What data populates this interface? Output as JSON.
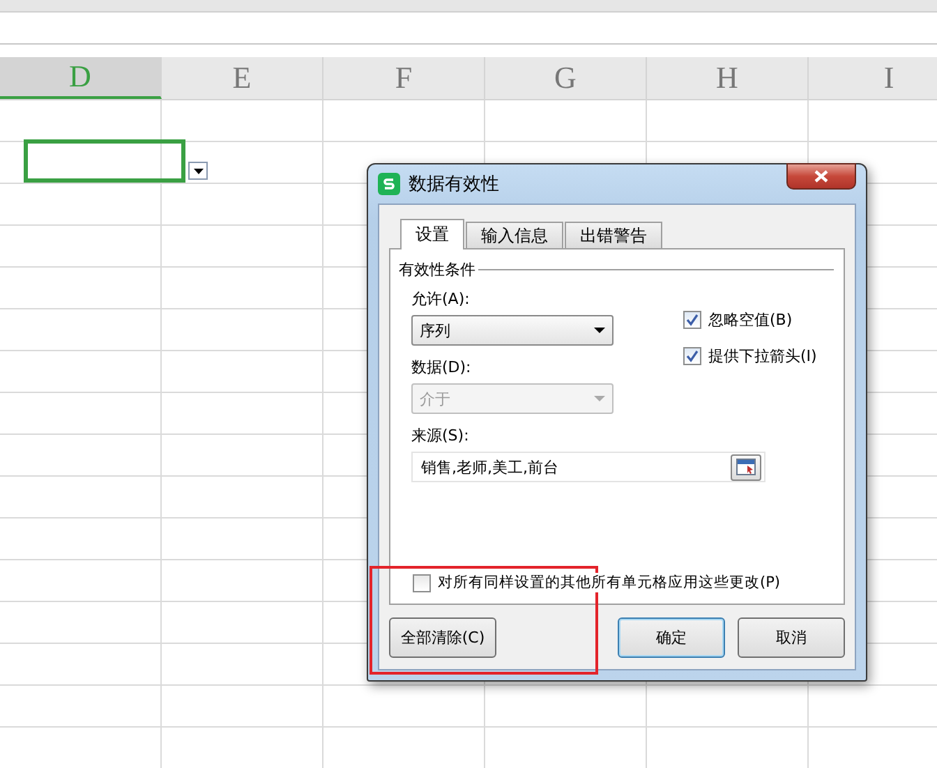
{
  "sheet": {
    "columns": [
      {
        "label": "D",
        "selected": true
      },
      {
        "label": "E",
        "selected": false
      },
      {
        "label": "F",
        "selected": false
      },
      {
        "label": "G",
        "selected": false
      },
      {
        "label": "H",
        "selected": false
      },
      {
        "label": "I",
        "selected": false
      }
    ]
  },
  "dialog": {
    "title": "数据有效性",
    "tabs": [
      {
        "label": "设置",
        "selected": true
      },
      {
        "label": "输入信息",
        "selected": false
      },
      {
        "label": "出错警告",
        "selected": false
      }
    ],
    "group": "有效性条件",
    "allow": {
      "label": "允许(A):",
      "value": "序列",
      "disabled": false
    },
    "data": {
      "label": "数据(D):",
      "value": "介于",
      "disabled": true
    },
    "options": [
      {
        "label": "忽略空值(B)",
        "checked": true
      },
      {
        "label": "提供下拉箭头(I)",
        "checked": true
      }
    ],
    "source": {
      "label": "来源(S):",
      "value": "销售,老师,美工,前台"
    },
    "apply_all": {
      "label": "对所有同样设置的其他所有单元格应用这些更改(P)",
      "checked": false
    },
    "buttons": [
      {
        "label": "全部清除(C)",
        "kind": "clear"
      },
      {
        "label": "确定",
        "kind": "ok"
      },
      {
        "label": "取消",
        "kind": "cancel"
      }
    ]
  }
}
